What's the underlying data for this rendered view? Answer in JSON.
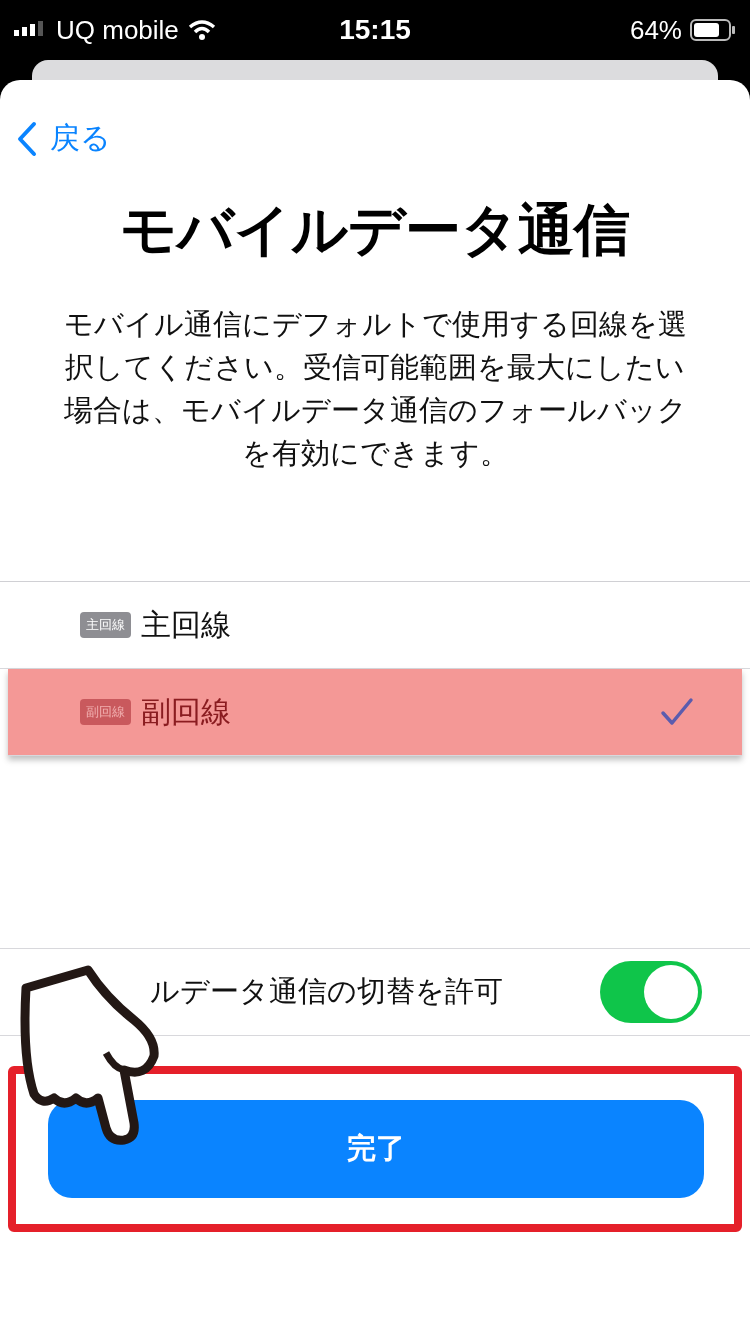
{
  "status_bar": {
    "carrier": "UQ mobile",
    "time": "15:15",
    "battery": "64%"
  },
  "nav": {
    "back": "戻る"
  },
  "title": "モバイルデータ通信",
  "description": "モバイル通信にデフォルトで使用する回線を選択してください。受信可能範囲を最大にしたい場合は、モバイルデータ通信のフォールバックを有効にできます。",
  "lines": [
    {
      "badge": "主回線",
      "label": "主回線",
      "selected": false
    },
    {
      "badge": "副回線",
      "label": "副回線",
      "selected": true
    }
  ],
  "switch_row": {
    "label": "ルデータ通信の切替を許可",
    "on": true
  },
  "done_button": "完了"
}
